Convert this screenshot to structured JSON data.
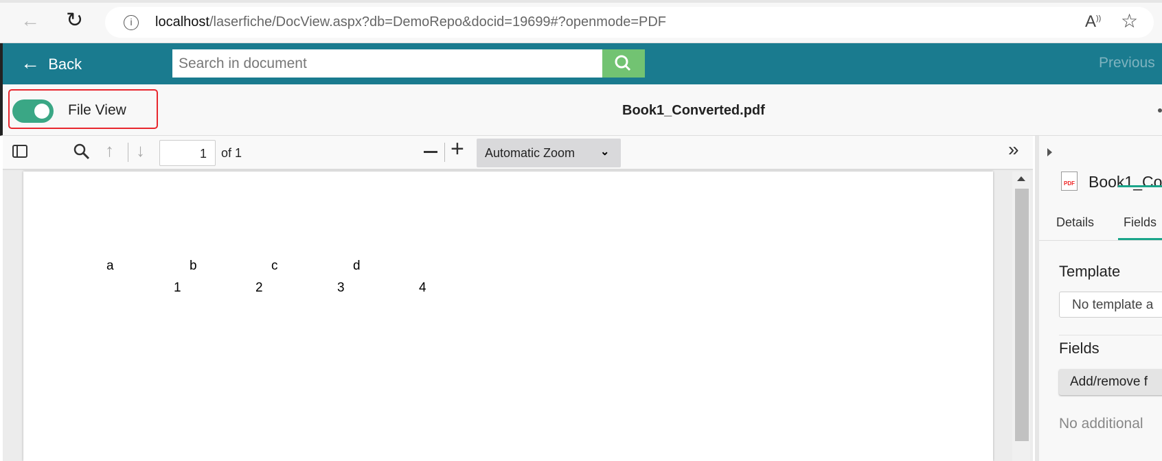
{
  "browser": {
    "url_host": "localhost",
    "url_path": "/laserfiche/DocView.aspx?db=DemoRepo&docid=19699#?openmode=PDF"
  },
  "header": {
    "back_label": "Back",
    "search_placeholder": "Search in document",
    "previous_label": "Previous"
  },
  "toolbar": {
    "file_view_label": "File View",
    "file_view_on": true,
    "document_title": "Book1_Converted.pdf"
  },
  "pdf_toolbar": {
    "page_number": "1",
    "page_count_label": "of 1",
    "zoom_option": "Automatic Zoom"
  },
  "pdf_content": {
    "row1": [
      "a",
      "b",
      "c",
      "d"
    ],
    "row2": [
      "1",
      "2",
      "3",
      "4"
    ]
  },
  "right_panel": {
    "doc_name": "Book1_Co",
    "pdf_badge": "PDF",
    "tabs": [
      "Details",
      "Fields"
    ],
    "active_tab": "Fields",
    "template_heading": "Template",
    "template_value": "No template a",
    "fields_heading": "Fields",
    "add_remove_label": "Add/remove f",
    "no_fields_text": "No additional"
  }
}
